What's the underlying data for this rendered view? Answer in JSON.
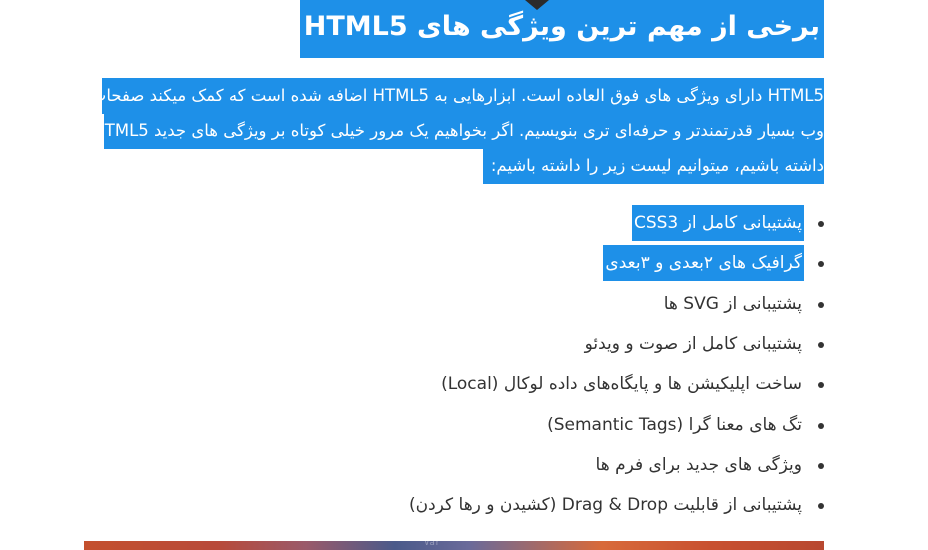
{
  "article": {
    "title": "برخی از مهم ترین ویژگی های HTML5",
    "intro_lines": [
      "HTML5 دارای ویژگی های فوق العاده است. ابزارهایی به HTML5 اضافه شده است که کمک میکند صفحات",
      "وب بسیار قدرتمندتر و حرفه‌ای تری بنویسیم. اگر بخواهیم یک مرور خیلی کوتاه بر ویژگی های جدید HTML5",
      "داشته باشیم، میتوانیم لیست زیر را داشته باشیم:"
    ],
    "features": [
      "پشتیبانی کامل از CSS3",
      "گرافیک های ۲بعدی و ۳بعدی",
      "پشتیبانی از SVG ها",
      "پشتیبانی کامل از صوت و ویدئو",
      "ساخت اپلیکیشن ها و پایگاه‌های داده لوکال (Local)",
      "تگ های معنا گرا (Semantic Tags)",
      "ویژگی های جدید برای فرم ها",
      "پشتیبانی از قابلیت Drag & Drop (کشیدن و رها کردن)"
    ],
    "selected_feature_count": 2,
    "bottom_image_text": "Var"
  },
  "colors": {
    "selection": "#1e90e8",
    "text": "#333333",
    "tooltip": "#2b2b2b"
  }
}
